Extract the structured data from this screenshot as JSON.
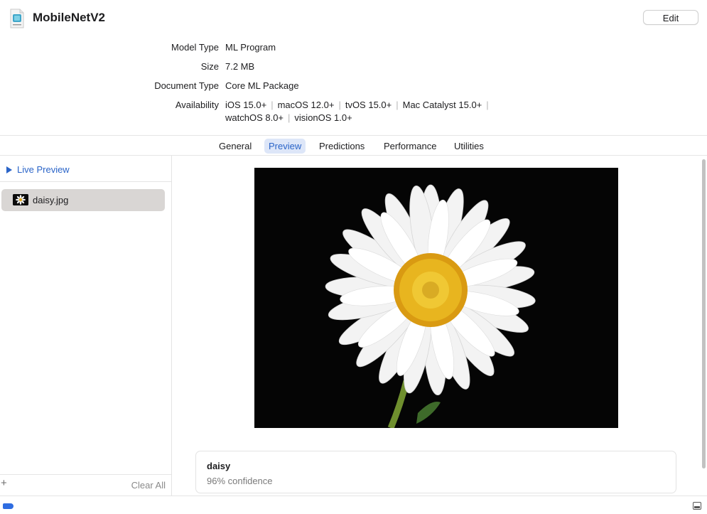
{
  "header": {
    "title": "MobileNetV2",
    "edit_label": "Edit",
    "app_icon": "ml-model-icon"
  },
  "info": {
    "model_type_label": "Model Type",
    "model_type_value": "ML Program",
    "size_label": "Size",
    "size_value": "7.2 MB",
    "document_type_label": "Document Type",
    "document_type_value": "Core ML Package",
    "availability_label": "Availability",
    "availability": [
      "iOS 15.0+",
      "macOS 12.0+",
      "tvOS 15.0+",
      "Mac Catalyst 15.0+",
      "watchOS 8.0+",
      "visionOS 1.0+"
    ]
  },
  "tabs": [
    {
      "label": "General",
      "active": false
    },
    {
      "label": "Preview",
      "active": true
    },
    {
      "label": "Predictions",
      "active": false
    },
    {
      "label": "Performance",
      "active": false
    },
    {
      "label": "Utilities",
      "active": false
    }
  ],
  "sidebar": {
    "live_preview_label": "Live Preview",
    "files": [
      {
        "name": "daisy.jpg",
        "selected": true
      }
    ],
    "add_label": "+",
    "clear_all_label": "Clear All"
  },
  "result": {
    "label": "daisy",
    "confidence": "96% confidence"
  },
  "colors": {
    "accent": "#2a64c8",
    "tab_active_bg": "#dde6f8",
    "selected_row_bg": "#d9d6d4",
    "status_badge": "#2f6de1"
  }
}
